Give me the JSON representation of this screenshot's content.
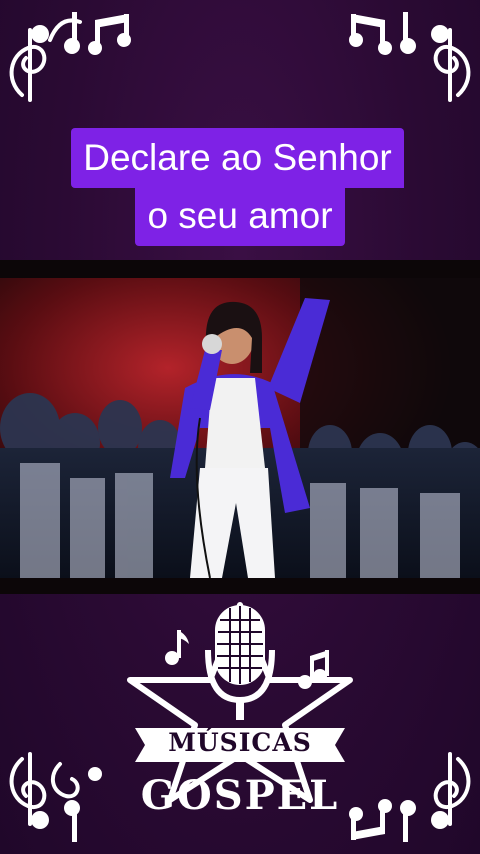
{
  "caption": {
    "line1": "Declare ao Senhor",
    "line2": "o seu amor",
    "background_color": "#7e22e6"
  },
  "logo": {
    "line1": "MÚSICAS",
    "line2": "GOSPEL"
  },
  "decorations": {
    "icons": [
      "music-note-icon",
      "treble-clef-icon",
      "microphone-icon",
      "star-icon"
    ]
  },
  "colors": {
    "background": "#2a0a33",
    "accent": "#7e22e6",
    "jacket": "#4a2bd6"
  }
}
